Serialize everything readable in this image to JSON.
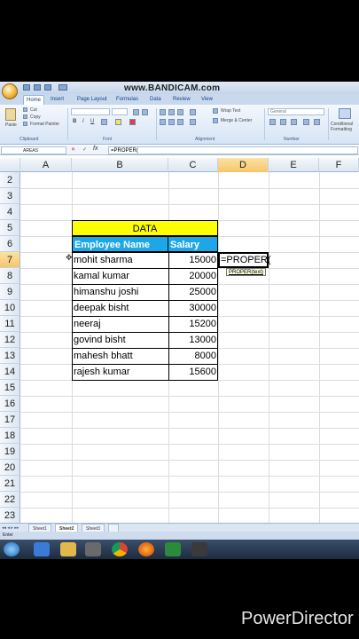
{
  "watermark": "www.BANDICAM.com",
  "tabs": [
    "Home",
    "Insert",
    "Page Layout",
    "Formulas",
    "Data",
    "Review",
    "View"
  ],
  "ribbon": {
    "clipboard_label": "Clipboard",
    "font_label": "Font",
    "alignment_label": "Alignment",
    "number_label": "Number",
    "paste": "Paste",
    "cut": "Cut",
    "copy": "Copy",
    "format_painter": "Format Painter",
    "wrap_text": "Wrap Text",
    "merge_center": "Merge & Center",
    "number_format": "General",
    "conditional": "Conditional Formatting"
  },
  "formula_bar": {
    "name_box": "AREAS",
    "cancel": "✕",
    "confirm": "✓",
    "fx": "fx",
    "formula": "=PROPER("
  },
  "columns": [
    "A",
    "B",
    "C",
    "D",
    "E",
    "F"
  ],
  "rows": [
    "2",
    "3",
    "4",
    "5",
    "6",
    "7",
    "8",
    "9",
    "10",
    "11",
    "12",
    "13",
    "14",
    "15",
    "16",
    "17",
    "18",
    "19",
    "20",
    "21",
    "22",
    "23"
  ],
  "table": {
    "title": "DATA",
    "header_name": "Employee Name",
    "header_salary": "Salary",
    "records": [
      {
        "name": "mohit sharma",
        "salary": "15000"
      },
      {
        "name": "kamal kumar",
        "salary": "20000"
      },
      {
        "name": "himanshu joshi",
        "salary": "25000"
      },
      {
        "name": "deepak bisht",
        "salary": "30000"
      },
      {
        "name": "neeraj",
        "salary": "15200"
      },
      {
        "name": "govind bisht",
        "salary": "13000"
      },
      {
        "name": "mahesh bhatt",
        "salary": "8000"
      },
      {
        "name": "rajesh kumar",
        "salary": "15600"
      }
    ]
  },
  "editing_cell": {
    "value": "=PROPER(",
    "tooltip": "PROPER(text)"
  },
  "sheets": [
    "Sheet1",
    "Sheet2",
    "Sheet3"
  ],
  "status": "Enter",
  "branding": "PowerDirector",
  "colors": {
    "title_fill": "#ffff00",
    "header_fill": "#1ea7e6",
    "selected_header": "#f6c56b"
  }
}
